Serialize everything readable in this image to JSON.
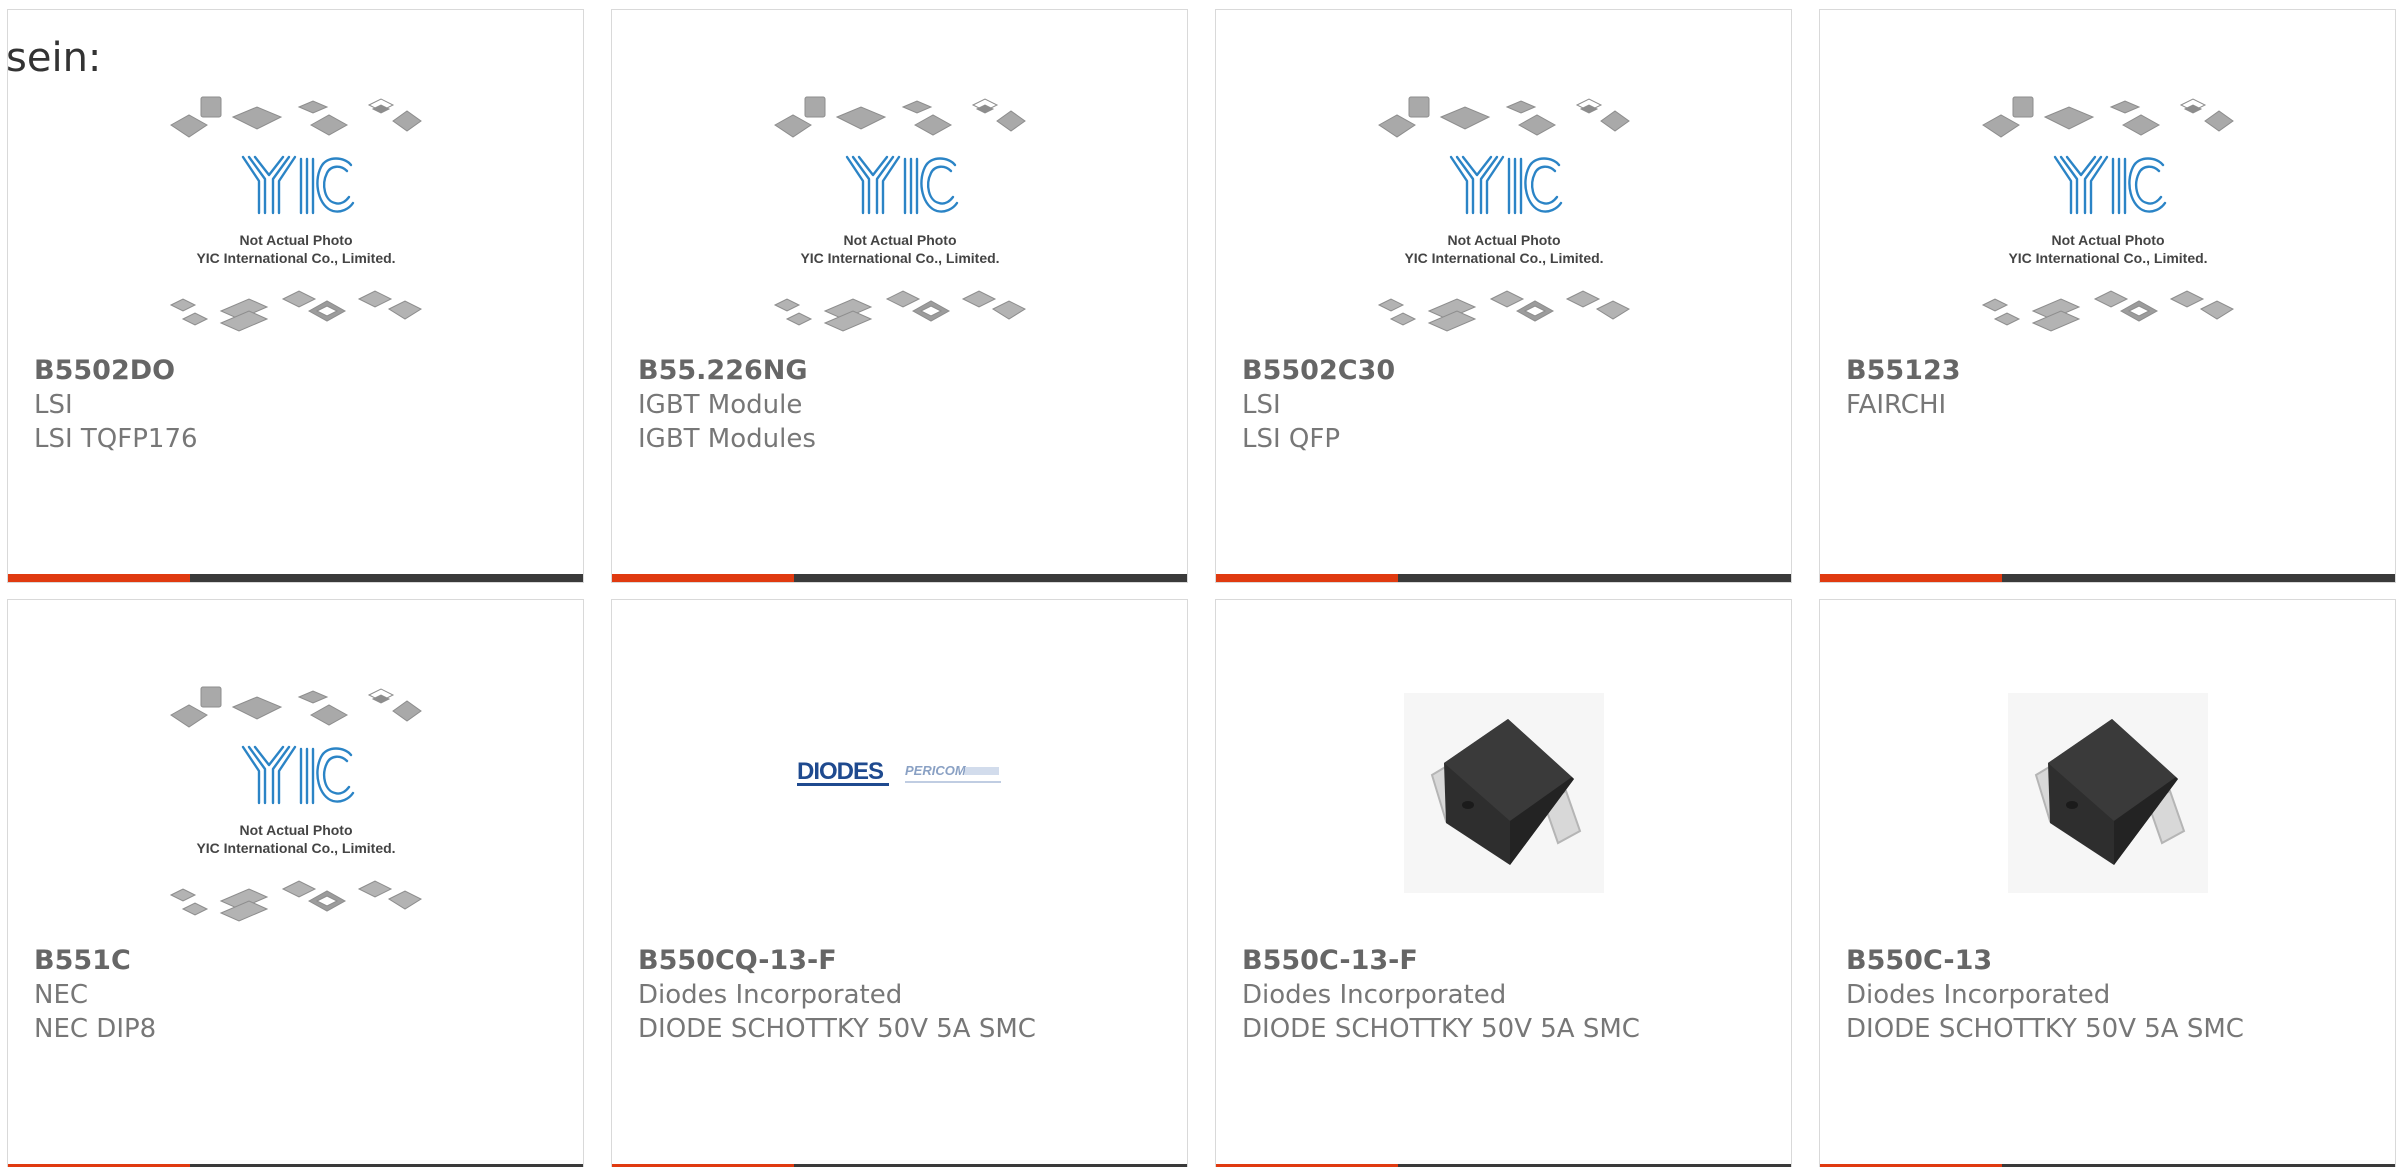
{
  "page": {
    "prefix_text": "sein:"
  },
  "colors": {
    "accent": "#e03a10",
    "bar": "#3a3a3a",
    "text": "#666666",
    "placeholder_blue": "#2b84c6"
  },
  "placeholder": {
    "logo_text": "YIC",
    "caption_line1": "Not Actual Photo",
    "caption_line2": "YIC International Co., Limited."
  },
  "products": [
    {
      "part_number": "B5502DO",
      "manufacturer": "LSI",
      "description": "LSI TQFP176",
      "image": "yic-placeholder-icon"
    },
    {
      "part_number": "B55.226NG",
      "manufacturer": "IGBT Module",
      "description": "IGBT Modules",
      "image": "yic-placeholder-icon"
    },
    {
      "part_number": "B5502C30",
      "manufacturer": "LSI",
      "description": "LSI QFP",
      "image": "yic-placeholder-icon"
    },
    {
      "part_number": "B55123",
      "manufacturer": "FAIRCHI",
      "description": "",
      "image": "yic-placeholder-icon"
    },
    {
      "part_number": "B551C",
      "manufacturer": "NEC",
      "description": "NEC DIP8",
      "image": "yic-placeholder-icon"
    },
    {
      "part_number": "B550CQ-13-F",
      "manufacturer": "Diodes Incorporated",
      "description": "DIODE SCHOTTKY 50V 5A SMC",
      "image": "diodes-pericom-logo"
    },
    {
      "part_number": "B550C-13-F",
      "manufacturer": "Diodes Incorporated",
      "description": "DIODE SCHOTTKY 50V 5A SMC",
      "image": "smc-diode-photo"
    },
    {
      "part_number": "B550C-13",
      "manufacturer": "Diodes Incorporated",
      "description": "DIODE SCHOTTKY 50V 5A SMC",
      "image": "smc-diode-photo"
    }
  ],
  "brand_logo": {
    "primary": "DIODES",
    "primary_sub": "INCORPORATED",
    "secondary": "PERICOM"
  }
}
